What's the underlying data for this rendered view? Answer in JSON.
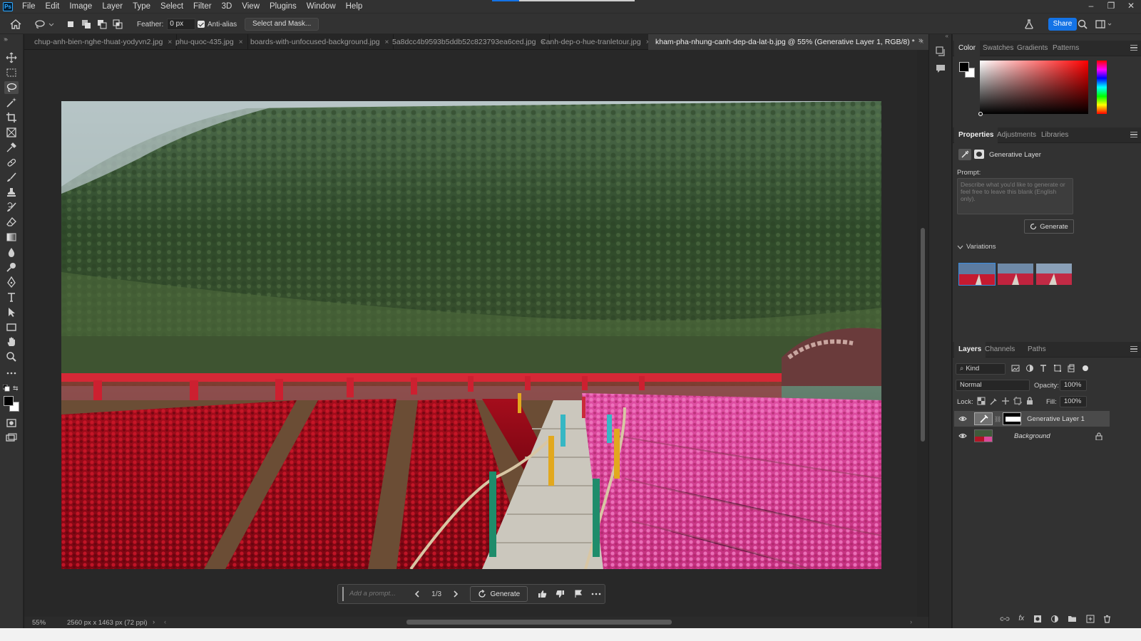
{
  "app": {
    "logo_text": "Ps",
    "menu": [
      "File",
      "Edit",
      "Image",
      "Layer",
      "Type",
      "Select",
      "Filter",
      "3D",
      "View",
      "Plugins",
      "Window",
      "Help"
    ],
    "window_buttons": [
      "–",
      "❐",
      "✕"
    ]
  },
  "options_bar": {
    "feather_label": "Feather:",
    "feather_value": "0 px",
    "antialias_label": "Anti-alias",
    "antialias_checked": true,
    "select_mask_label": "Select and Mask...",
    "share_label": "Share"
  },
  "tabs": [
    {
      "label": "chup-anh-bien-nghe-thuat-yodyvn2.jpg",
      "active": false
    },
    {
      "label": "phu-quoc-435.jpg",
      "active": false
    },
    {
      "label": "boards-with-unfocused-background.jpg",
      "active": false
    },
    {
      "label": "5a8dcc4b9593b5ddb52c823793ea6ced.jpg",
      "active": false
    },
    {
      "label": "Canh-dep-o-hue-tranletour.jpg",
      "active": false
    },
    {
      "label": "kham-pha-nhung-canh-dep-da-lat-b.jpg @ 55% (Generative Layer 1, RGB/8) *",
      "active": true
    }
  ],
  "taskbar": {
    "prompt_placeholder": "Add a prompt...",
    "variation_counter": "1/3",
    "generate_label": "Generate"
  },
  "status": {
    "zoom": "55%",
    "doc_info": "2560 px x 1463 px (72 ppi)"
  },
  "color_panel": {
    "tabs": [
      "Color",
      "Swatches",
      "Gradients",
      "Patterns"
    ],
    "active_tab": "Color",
    "foreground": "#000000",
    "background": "#ffffff",
    "hue_color": "#ff0000"
  },
  "properties_panel": {
    "tabs": [
      "Properties",
      "Adjustments",
      "Libraries"
    ],
    "layer_type": "Generative Layer",
    "prompt_label": "Prompt:",
    "prompt_placeholder": "Describe what you'd like to generate or feel free to leave this blank (English only).",
    "generate_label": "Generate",
    "variations_label": "Variations",
    "variation_count": 3,
    "selected_variation": 1
  },
  "layers_panel": {
    "tabs": [
      "Layers",
      "Channels",
      "Paths"
    ],
    "filter_label": "Kind",
    "blend_mode": "Normal",
    "opacity_label": "Opacity:",
    "opacity_value": "100%",
    "lock_label": "Lock:",
    "fill_label": "Fill:",
    "fill_value": "100%",
    "layers": [
      {
        "name": "Generative Layer 1",
        "selected": true,
        "locked": false,
        "visible": true
      },
      {
        "name": "Background",
        "selected": false,
        "locked": true,
        "visible": true
      }
    ]
  }
}
